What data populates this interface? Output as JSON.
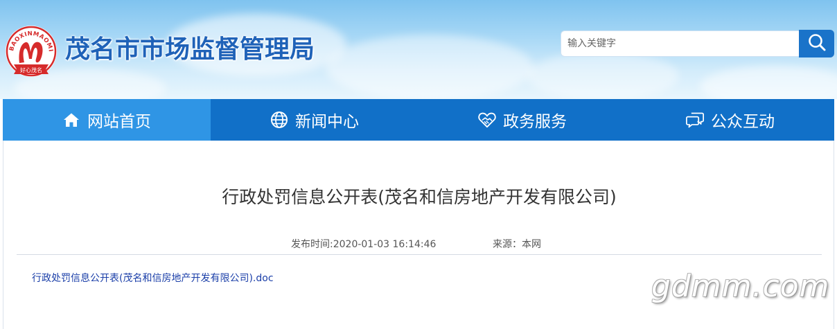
{
  "header": {
    "site_title": "茂名市市场监督管理局",
    "logo": {
      "icon": "emblem-logo",
      "arc_text": "BAOXINMAOMING",
      "ribbon_text": "好心茂名",
      "colors": {
        "red": "#d62b2b",
        "white": "#ffffff"
      }
    },
    "search": {
      "placeholder": "输入关键字",
      "icon": "search-icon"
    }
  },
  "nav": {
    "items": [
      {
        "label": "网站首页",
        "icon": "home-icon",
        "active": true
      },
      {
        "label": "新闻中心",
        "icon": "globe-icon",
        "active": false
      },
      {
        "label": "政务服务",
        "icon": "handshake-icon",
        "active": false
      },
      {
        "label": "公众互动",
        "icon": "chat-icon",
        "active": false
      }
    ]
  },
  "article": {
    "title": "行政处罚信息公开表(茂名和信房地产开发有限公司)",
    "publish_time": "发布时间:2020-01-03 16:14:46",
    "source": "来源：本网",
    "attachment": "行政处罚信息公开表(茂名和信房地产开发有限公司).doc"
  },
  "watermark": "gdmm.com",
  "colors": {
    "nav_bg": "#1170c8",
    "nav_active_bg": "#2f95e5",
    "title_blue": "#1f62b8",
    "search_button": "#1a73c9",
    "link": "#1a3ea8"
  }
}
